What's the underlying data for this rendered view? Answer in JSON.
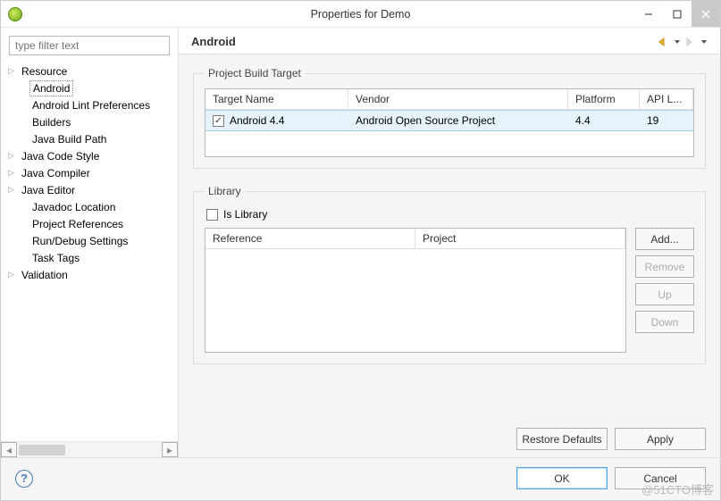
{
  "window": {
    "title": "Properties for Demo"
  },
  "filter": {
    "placeholder": "type filter text"
  },
  "tree": [
    {
      "label": "Resource",
      "expandable": true
    },
    {
      "label": "Android",
      "selected": true,
      "indent": true
    },
    {
      "label": "Android Lint Preferences",
      "indent": true
    },
    {
      "label": "Builders",
      "indent": true
    },
    {
      "label": "Java Build Path",
      "indent": true
    },
    {
      "label": "Java Code Style",
      "expandable": true
    },
    {
      "label": "Java Compiler",
      "expandable": true
    },
    {
      "label": "Java Editor",
      "expandable": true
    },
    {
      "label": "Javadoc Location",
      "indent": true
    },
    {
      "label": "Project References",
      "indent": true
    },
    {
      "label": "Run/Debug Settings",
      "indent": true
    },
    {
      "label": "Task Tags",
      "indent": true
    },
    {
      "label": "Validation",
      "expandable": true
    }
  ],
  "main": {
    "heading": "Android",
    "buildTarget": {
      "legend": "Project Build Target",
      "headers": {
        "name": "Target Name",
        "vendor": "Vendor",
        "platform": "Platform",
        "api": "API L..."
      },
      "rows": [
        {
          "checked": true,
          "name": "Android 4.4",
          "vendor": "Android Open Source Project",
          "platform": "4.4",
          "api": "19"
        }
      ]
    },
    "library": {
      "legend": "Library",
      "isLibrary": {
        "label": "Is Library",
        "checked": false
      },
      "headers": {
        "reference": "Reference",
        "project": "Project"
      },
      "buttons": {
        "add": "Add...",
        "remove": "Remove",
        "up": "Up",
        "down": "Down"
      }
    }
  },
  "buttons": {
    "restore": "Restore Defaults",
    "apply": "Apply",
    "ok": "OK",
    "cancel": "Cancel"
  },
  "watermark": "@51CTO博客"
}
